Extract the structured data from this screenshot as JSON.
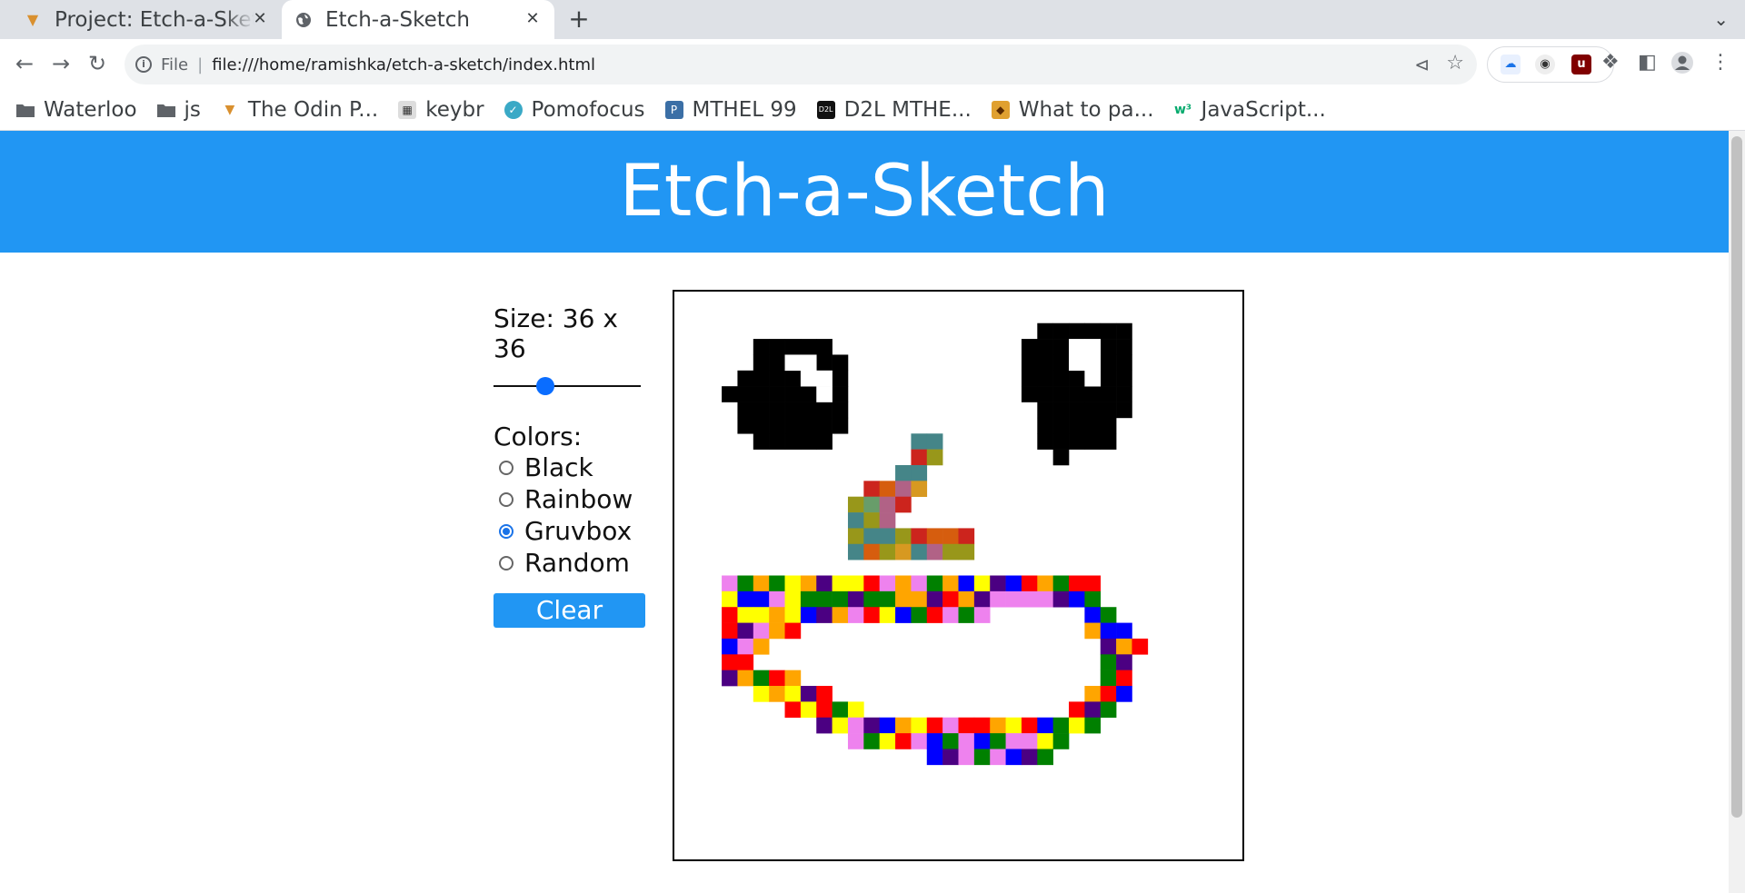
{
  "browser": {
    "tabs": [
      {
        "title": "Project: Etch-a-Sketch",
        "active": false,
        "icon": "odin-icon"
      },
      {
        "title": "Etch-a-Sketch",
        "active": true,
        "icon": "globe-icon"
      }
    ],
    "url_chip": "File",
    "url": "file:///home/ramishka/etch-a-sketch/index.html",
    "bookmarks": [
      {
        "label": "Waterloo",
        "icon": "folder-icon"
      },
      {
        "label": "js",
        "icon": "folder-icon"
      },
      {
        "label": "The Odin P...",
        "icon": "odin-icon"
      },
      {
        "label": "keybr",
        "icon": "keybr-icon"
      },
      {
        "label": "Pomofocus",
        "icon": "check-circle-icon"
      },
      {
        "label": "MTHEL 99",
        "icon": "p-icon"
      },
      {
        "label": "D2L MTHE...",
        "icon": "d2l-icon"
      },
      {
        "label": "What to pa...",
        "icon": "shield-icon"
      },
      {
        "label": "JavaScript...",
        "icon": "w3-icon"
      }
    ]
  },
  "app": {
    "title": "Etch-a-Sketch",
    "size_label": "Size: 36 x 36",
    "grid_size": 36,
    "slider_value_fraction": 0.35,
    "colors_label": "Colors:",
    "color_options": [
      {
        "label": "Black",
        "checked": false
      },
      {
        "label": "Rainbow",
        "checked": false
      },
      {
        "label": "Gruvbox",
        "checked": true
      },
      {
        "label": "Random",
        "checked": false
      }
    ],
    "clear_label": "Clear",
    "colors": {
      "header": "#2196f3",
      "black": "#000000",
      "rainbow": [
        "#ff0000",
        "#ffa500",
        "#ffff00",
        "#008000",
        "#0000ff",
        "#4b0082",
        "#ee82ee"
      ],
      "gruvbox": [
        "#cc241d",
        "#98971a",
        "#d79921",
        "#458588",
        "#b16286",
        "#689d6a",
        "#d65d0e"
      ]
    }
  }
}
